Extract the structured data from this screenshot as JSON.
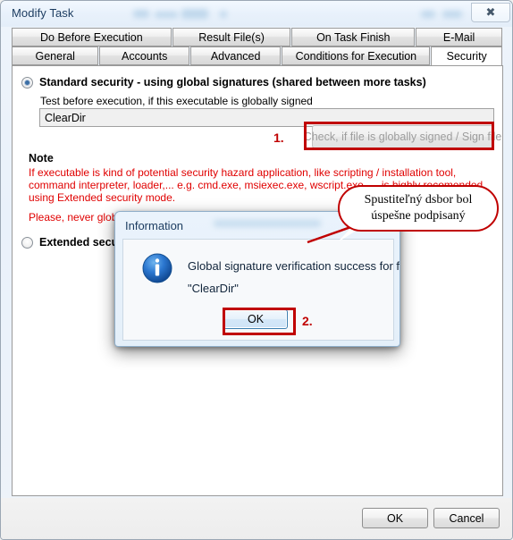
{
  "window": {
    "title": "Modify Task",
    "close_icon": "close-icon"
  },
  "tabs": {
    "row1": [
      {
        "label": "Do Before Execution",
        "selected": false
      },
      {
        "label": "Result File(s)",
        "selected": false
      },
      {
        "label": "On Task Finish",
        "selected": false
      },
      {
        "label": "E-Mail",
        "selected": false
      }
    ],
    "row2": [
      {
        "label": "General",
        "selected": false
      },
      {
        "label": "Accounts",
        "selected": false
      },
      {
        "label": "Advanced",
        "selected": false
      },
      {
        "label": "Conditions for Execution",
        "selected": false
      },
      {
        "label": "Security",
        "selected": true
      }
    ]
  },
  "security_page": {
    "standard_radio_label": "Standard security - using global signatures (shared between more tasks)",
    "test_label": "Test before execution, if this executable is globally signed",
    "executable_value": "ClearDir",
    "check_button_label": "Check, if file is globally signed / Sign file",
    "note_heading": "Note",
    "note_text": "If executable is kind of potential security hazard application, like scripting / installation tool, command interpreter, loader,... e.g. cmd.exe, msiexec.exe, wscript.exe,..., is highly recomended using Extended security mode.",
    "note_text2": "Please, never globa",
    "extended_radio_label": "Extended securi"
  },
  "annotations": {
    "step1": "1.",
    "step2": "2.",
    "callout_line1": "Spustiteľný dsbor bol",
    "callout_line2": "úspešne podpisaný",
    "accent_color": "#c00000"
  },
  "dialog": {
    "title": "Information",
    "icon": "info-icon",
    "message_line1": "Global signature verification success for file",
    "message_line2": "\"ClearDir\"",
    "ok_label": "OK"
  },
  "footer": {
    "ok_label": "OK",
    "cancel_label": "Cancel"
  }
}
